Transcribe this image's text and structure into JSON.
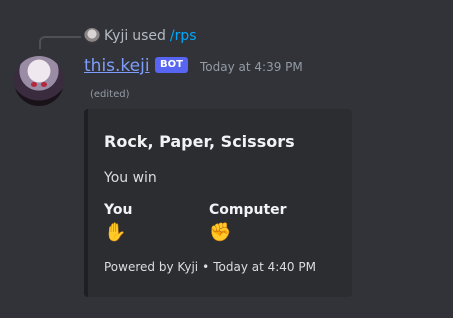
{
  "reply": {
    "username": "Kyji",
    "used_label": "used",
    "command": "/rps"
  },
  "message": {
    "author": "this.keji",
    "badge": "BOT",
    "timestamp": "Today at 4:39 PM",
    "edited": "(edited)"
  },
  "embed": {
    "title": "Rock, Paper, Scissors",
    "description": "You win",
    "fields": [
      {
        "name": "You",
        "value": "✋"
      },
      {
        "name": "Computer",
        "value": "✊"
      }
    ],
    "footer": {
      "text": "Powered by Kyji",
      "separator": "•",
      "timestamp": "Today at 4:40 PM"
    }
  },
  "colors": {
    "background": "#313338",
    "embed_background": "#2b2d31",
    "username": "#7f9dfb",
    "badge": "#5865f2",
    "command": "#00a8fc"
  }
}
